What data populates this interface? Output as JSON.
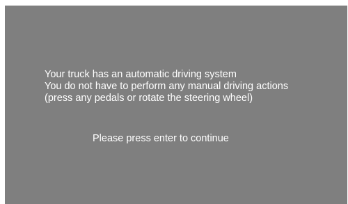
{
  "colors": {
    "panel_background": "#7f7f7f",
    "text": "#ffffff",
    "page_background": "#ffffff"
  },
  "message": {
    "lines": [
      "Your truck has an automatic driving system",
      "You do not have to perform any manual driving actions",
      "(press any pedals or rotate the steering wheel)"
    ]
  },
  "prompt": {
    "text": "Please press enter to continue"
  }
}
